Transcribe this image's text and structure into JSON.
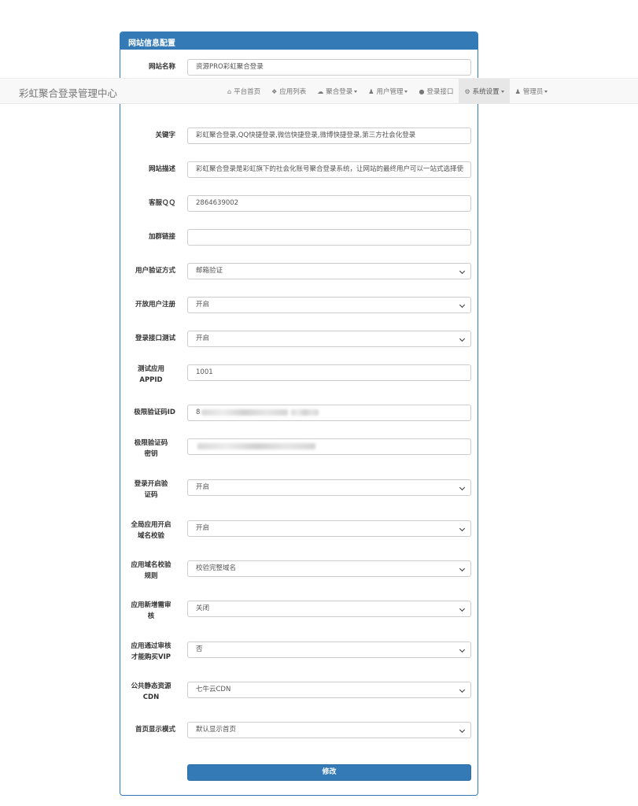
{
  "navbar": {
    "brand": "彩虹聚合登录管理中心",
    "items": [
      {
        "label": "平台首页",
        "icon": "home-icon",
        "glyph": "⌂",
        "caret": false
      },
      {
        "label": "应用列表",
        "icon": "cubes-icon",
        "glyph": "❖",
        "caret": false
      },
      {
        "label": "聚合登录",
        "icon": "cloud-icon",
        "glyph": "☁",
        "caret": true
      },
      {
        "label": "用户管理",
        "icon": "user-icon",
        "glyph": "♟",
        "caret": true
      },
      {
        "label": "登录接口",
        "icon": "plug-icon",
        "glyph": "●",
        "caret": false
      },
      {
        "label": "系统设置",
        "icon": "gear-icon",
        "glyph": "⚙",
        "caret": true,
        "active": true
      },
      {
        "label": "管理员",
        "icon": "user-icon",
        "glyph": "♟",
        "caret": true
      }
    ]
  },
  "panel": {
    "title": "网站信息配置",
    "fields": [
      {
        "label": "网站名称",
        "value": "资源PRO彩虹聚合登录",
        "type": "input"
      },
      {
        "label": "关键字",
        "value": "彩虹聚合登录,QQ快捷登录,微信快捷登录,微博快捷登录,第三方社会化登录",
        "type": "input"
      },
      {
        "label": "网站描述",
        "value": "彩虹聚合登录是彩虹旗下的社会化账号聚合登录系统，让网站的最终用户可以一站式选择使",
        "type": "input"
      },
      {
        "label": "客服ＱＱ",
        "value": "2864639002",
        "type": "input"
      },
      {
        "label": "加群链接",
        "value": "",
        "type": "input"
      },
      {
        "label": "用户验证方式",
        "value": "邮箱验证",
        "type": "select"
      },
      {
        "label": "开放用户注册",
        "value": "开启",
        "type": "select"
      },
      {
        "label": "登录接口测试",
        "value": "开启",
        "type": "select"
      },
      {
        "label": "测试应用APPID",
        "value": "1001",
        "type": "input"
      },
      {
        "label": "极限验证码ID",
        "value": "8",
        "type": "input",
        "masked": true
      },
      {
        "label": "极限验证码密钥",
        "value": "",
        "type": "input",
        "masked": true
      },
      {
        "label": "登录开启验证码",
        "value": "开启",
        "type": "select"
      },
      {
        "label": "全局应用开启域名校验",
        "value": "开启",
        "type": "select"
      },
      {
        "label": "应用域名校验规则",
        "value": "校验完整域名",
        "type": "select"
      },
      {
        "label": "应用新增需审核",
        "value": "关闭",
        "type": "select"
      },
      {
        "label": "应用通过审核才能购买VIP",
        "value": "否",
        "type": "select"
      },
      {
        "label": "公共静态资源CDN",
        "value": "七牛云CDN",
        "type": "select"
      },
      {
        "label": "首页显示模式",
        "value": "默认显示首页",
        "type": "select"
      }
    ],
    "submit_label": "修改"
  },
  "colors": {
    "primary": "#337ab7",
    "navbar_bg": "#f8f8f8",
    "active_bg": "#e7e7e7"
  }
}
